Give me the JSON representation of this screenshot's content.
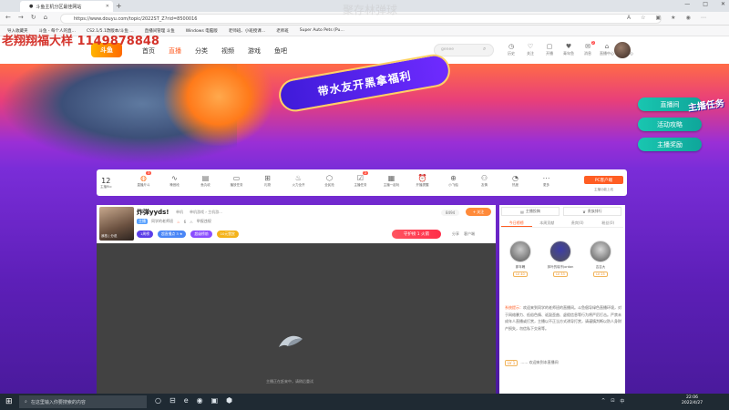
{
  "browser": {
    "tab_title": "斗鱼主机分区最佳网站",
    "new_tab": "+",
    "url": "https://www.douyu.com/topic/2022ST_Z?rid=8500016",
    "win_min": "—",
    "win_max": "□",
    "win_close": "✕",
    "bookmarks": [
      "导入收藏夹",
      "斗鱼 - 每个人的直…",
      "CS2.1/5.1改版本/斗鱼 …",
      "直播间管理 斗鱼",
      "Windows 电脑版",
      "老师班、小班授课…",
      "老师班",
      "Super Auto Pets (Pu…"
    ]
  },
  "watermark": {
    "owner": "老翔翔福大样 1149878848",
    "faint": "聚存林弹球"
  },
  "site": {
    "logo": "斗鱼",
    "nav": [
      "首页",
      "直播",
      "分类",
      "视频",
      "游戏",
      "鱼吧"
    ],
    "search_placeholder": "genee",
    "user_icons": [
      {
        "g": "◷",
        "l": "历史"
      },
      {
        "g": "♡",
        "l": "关注"
      },
      {
        "g": "▢",
        "l": "开播"
      },
      {
        "g": "♥",
        "l": "青年鱼"
      },
      {
        "g": "✉",
        "l": "消息",
        "badge": "2"
      },
      {
        "g": "⌂",
        "l": "直播中心"
      },
      {
        "g": "◉",
        "l": "宝石中心"
      }
    ]
  },
  "banner": {
    "text": "带水友开黑拿福利",
    "side_buttons": [
      "直播间",
      "活动攻略",
      "主播奖励"
    ],
    "rank_tag": "主播任务"
  },
  "toolbar": {
    "count": "12",
    "count_label": "主播Rio",
    "items": [
      {
        "g": "◍",
        "l": "直播斤斗",
        "o": true,
        "badge": "3"
      },
      {
        "g": "∿",
        "l": "嗓音段"
      },
      {
        "g": "▤",
        "l": "鱼丸收"
      },
      {
        "g": "▭",
        "l": "播放任务"
      },
      {
        "g": "⊞",
        "l": "礼物"
      },
      {
        "g": "♨",
        "l": "火力全开"
      },
      {
        "g": "⬡",
        "l": "全民抢"
      },
      {
        "g": "☑",
        "l": "主播任务",
        "badge": "2"
      },
      {
        "g": "▦",
        "l": "主播一起玩"
      },
      {
        "g": "⏰",
        "l": "开播提醒"
      },
      {
        "g": "⊕",
        "l": "小飞船"
      },
      {
        "g": "⚇",
        "l": "友情"
      },
      {
        "g": "◔",
        "l": "热度"
      },
      {
        "g": "⋯",
        "l": "更多"
      }
    ],
    "pc_button": "PC客户端",
    "pc_sub": "主播功能上线"
  },
  "room": {
    "title": "炸弹yyds!",
    "category": [
      "单机",
      "单机游戏 › 主机游..."
    ],
    "badge_tag": "主播",
    "anchor_label": "同学的老师班",
    "level": "6",
    "report": "举报违规",
    "avatar_label": "我档 | 分说",
    "pills": [
      {
        "t": "1周榜",
        "c": "#5b3ee8"
      },
      {
        "t": "超直播点 3 ★",
        "c": "#4a86f6"
      },
      {
        "t": "超级榜前",
        "c": "#8a4dff"
      },
      {
        "t": "10元赞赏",
        "c": "#f4b31a"
      }
    ],
    "hot": "8494",
    "follow": "+ 关注",
    "guard": "守护榜 1 火箭",
    "share": [
      "分享",
      "客户端"
    ],
    "player_text": "主播正在赶来中，请稍后重试"
  },
  "rpanel": {
    "tabs1": [
      "主播投稿",
      "贵族排行"
    ],
    "tabs2": [
      "今日榜榜",
      "本周贡献",
      "贵宾(0)",
      "粉丝(0)"
    ],
    "ranks": [
      {
        "name": "那年魄",
        "lv": "LV 40",
        "c": "#c9c9c9"
      },
      {
        "name": "抹叶的晓不Jordan",
        "lv": "LV 33",
        "c": "#3c3ca8"
      },
      {
        "name": "吉吉大",
        "lv": "LV 25",
        "c": "#d8d8d8"
      }
    ],
    "notice_tag": "系统提示：",
    "notice": "欢迎来到同学的老师班的直播间。斗鱼倡导绿色直播环境，对于网络暴力、低俗色情、诋毁歪曲、虚假信息等行为将严厉打击。严禁未成年人直播或打赏，主播以不正当方式诱导打赏，请谨慎判断以防人身财产损失，勿信私下交易等。",
    "welcome_lv": "LV 1",
    "welcome": "…… 欢迎来到本直播间"
  },
  "taskbar": {
    "search": "在这里输入你要搜索的内容",
    "time": "22:06",
    "date": "2022/4/27",
    "icons": [
      "○",
      "⊟",
      "e",
      "◉",
      "▣",
      "⬢"
    ],
    "tray": [
      "^",
      "⊡",
      "中"
    ]
  }
}
